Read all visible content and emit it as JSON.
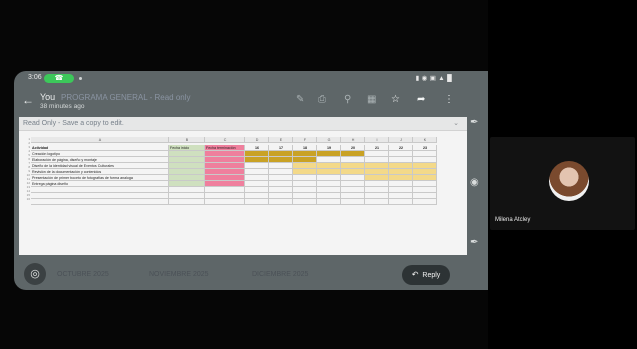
{
  "status_bar": {
    "time": "3:06",
    "call": ""
  },
  "app_bar": {
    "sender": "You",
    "file_name": "PROGRAMA GENERAL - Read only",
    "time_ago": "38 minutes ago"
  },
  "readonly": {
    "text": "Read Only - Save a copy to edit."
  },
  "spreadsheet": {
    "column_letters": [
      "A",
      "B",
      "C",
      "D",
      "E",
      "F",
      "G",
      "H",
      "I",
      "J",
      "K",
      "L"
    ],
    "headers": [
      "Actividad",
      "Fecha inicio",
      "Fecha terminación",
      "16",
      "17",
      "18",
      "19",
      "20",
      "21",
      "22",
      "23"
    ],
    "rows": [
      [
        "Creación logotipo",
        "",
        ""
      ],
      [
        "Elaboración de página, diseño y montaje",
        "",
        ""
      ],
      [
        "Diseño de la identidad visual de Eventos Culturales",
        "",
        ""
      ],
      [
        "Revisión de la documentación y contenidos",
        "",
        ""
      ],
      [
        "Presentación de primer boceto de fotografías de forma analoga",
        "",
        ""
      ],
      [
        "Entrega página diseño",
        "",
        ""
      ]
    ],
    "colors": {
      "start": "#cfe0bf",
      "end": "#ef7f9d",
      "gantt_dark": "#c9a225",
      "gantt_light": "#f3d989"
    }
  },
  "bottom_tabs": [
    "OCTUBRE 2025",
    "NOVIEMBRE 2025",
    "DICIEMBRE 2025"
  ],
  "reply": {
    "label": "Reply"
  },
  "participant": {
    "name": "Milena Atcley"
  }
}
